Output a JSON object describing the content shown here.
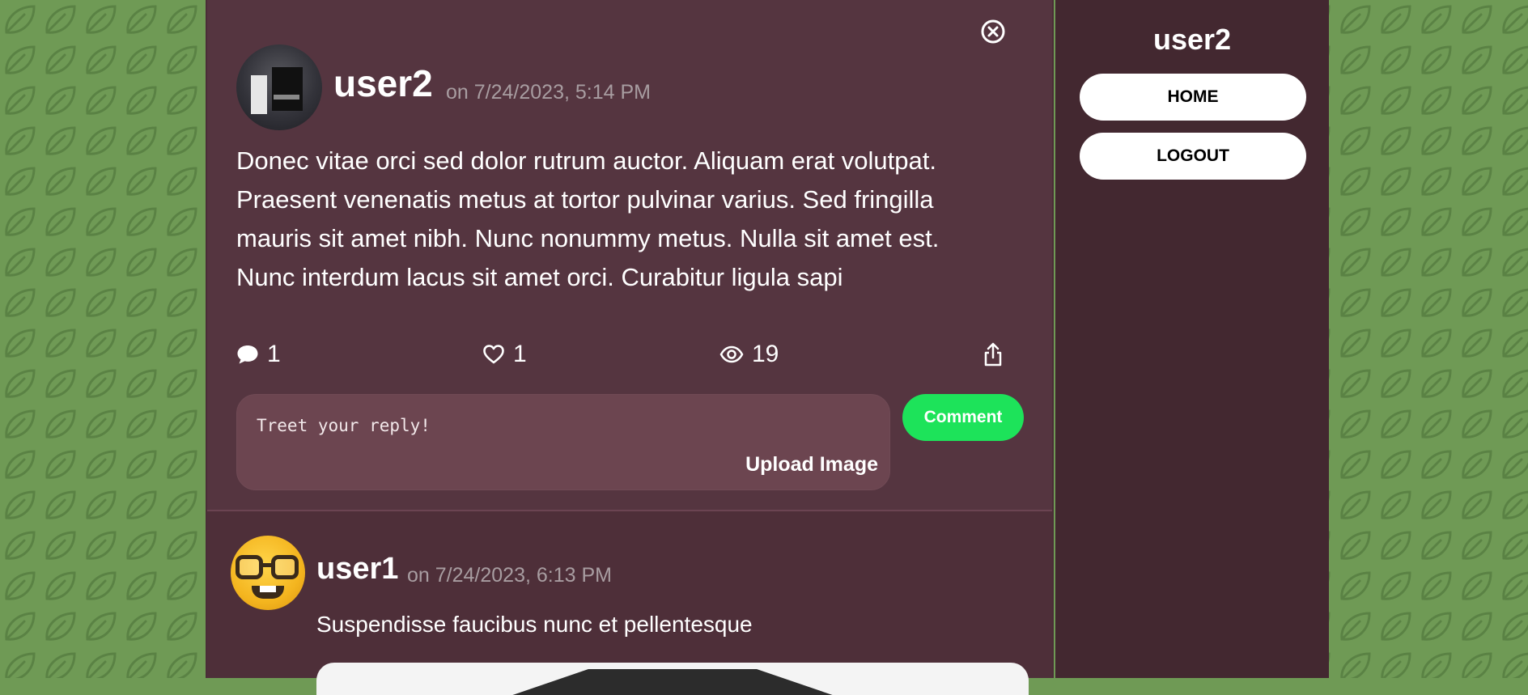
{
  "post": {
    "username": "user2",
    "date": "on 7/24/2023, 5:14 PM",
    "body": "Donec vitae orci sed dolor rutrum auctor. Aliquam erat volutpat. Praesent venenatis metus at tortor pulvinar varius. Sed fringilla mauris sit amet nibh. Nunc nonummy metus. Nulla sit amet est. Nunc interdum lacus sit amet orci. Curabitur ligula sapi",
    "avatar_icon": "kitchen-photo-avatar",
    "stats": {
      "comments": "1",
      "likes": "1",
      "views": "19"
    }
  },
  "reply": {
    "placeholder": "Treet your reply!",
    "upload_label": "Upload Image",
    "comment_label": "Comment"
  },
  "comment": {
    "username": "user1",
    "date": "on 7/24/2023, 6:13 PM",
    "text": "Suspendisse faucibus nunc et pellentesque",
    "avatar_icon": "nerd-emoji-avatar"
  },
  "sidebar": {
    "username": "user2",
    "home_label": "HOME",
    "logout_label": "LOGOUT"
  },
  "colors": {
    "page_bg": "#6f9a55",
    "feed_bg": "#553540",
    "sidebar_bg": "#432830",
    "reply_box_bg": "#6c4550",
    "comment_button": "#1de35a",
    "muted_text": "#a89da1"
  },
  "icons": {
    "close": "close-circle-icon",
    "comments": "speech-bubble-icon",
    "likes": "heart-icon",
    "views": "eye-icon",
    "share": "share-icon",
    "background": "leaf-pattern"
  }
}
